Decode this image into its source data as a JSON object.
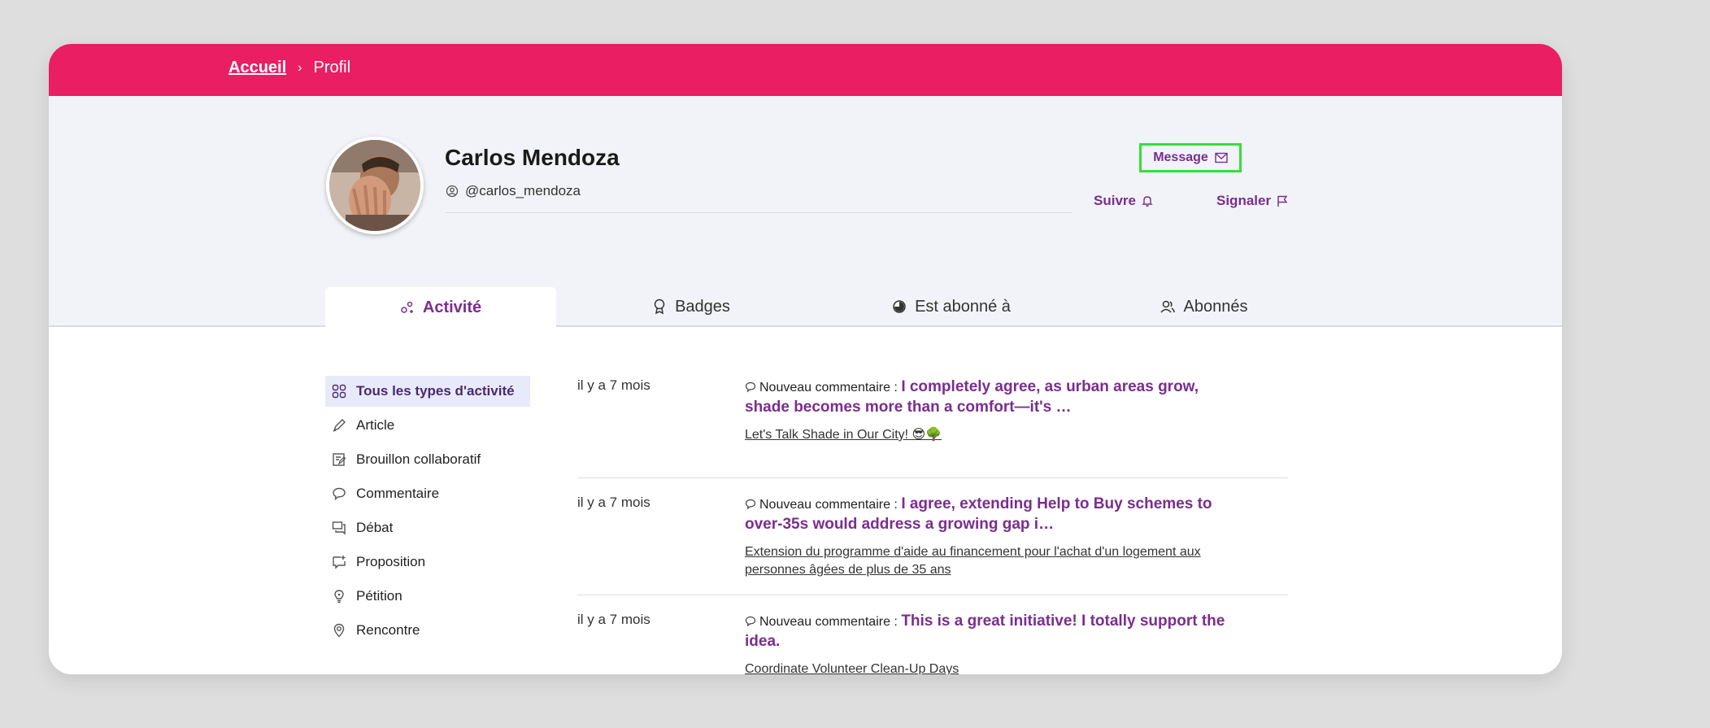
{
  "breadcrumb": {
    "home": "Accueil",
    "separator": "›",
    "current": "Profil"
  },
  "profile": {
    "name": "Carlos Mendoza",
    "handle": "@carlos_mendoza"
  },
  "actions": {
    "message": "Message",
    "follow": "Suivre",
    "report": "Signaler"
  },
  "tabs": [
    {
      "label": "Activité",
      "icon": "activity-icon"
    },
    {
      "label": "Badges",
      "icon": "badge-icon"
    },
    {
      "label": "Est abonné à",
      "icon": "following-icon"
    },
    {
      "label": "Abonnés",
      "icon": "followers-icon"
    }
  ],
  "filters": [
    {
      "label": "Tous les types d'activité",
      "icon": "grid-icon"
    },
    {
      "label": "Article",
      "icon": "pen-icon"
    },
    {
      "label": "Brouillon collaboratif",
      "icon": "draft-icon"
    },
    {
      "label": "Commentaire",
      "icon": "comment-icon"
    },
    {
      "label": "Débat",
      "icon": "debate-icon"
    },
    {
      "label": "Proposition",
      "icon": "proposal-icon"
    },
    {
      "label": "Pétition",
      "icon": "bulb-icon"
    },
    {
      "label": "Rencontre",
      "icon": "location-icon"
    }
  ],
  "activities": [
    {
      "time": "il y a 7 mois",
      "type": "Nouveau commentaire :",
      "excerpt": "I completely agree, as urban areas grow, shade becomes more than a comfort—it's …",
      "link": "Let's Talk Shade in Our City! 😎🌳"
    },
    {
      "time": "il y a 7 mois",
      "type": "Nouveau commentaire :",
      "excerpt": "I agree, extending Help to Buy schemes to over-35s would address a growing gap i…",
      "link": "Extension du programme d'aide au financement pour l'achat d'un logement aux personnes âgées de plus de 35 ans"
    },
    {
      "time": "il y a 7 mois",
      "type": "Nouveau commentaire :",
      "excerpt": "This is a great initiative! I totally support the idea.",
      "link": "Coordinate Volunteer Clean-Up Days"
    }
  ],
  "colors": {
    "accent": "#e91e63",
    "brand_purple": "#7b2d8f",
    "highlight": "#32e03a"
  }
}
